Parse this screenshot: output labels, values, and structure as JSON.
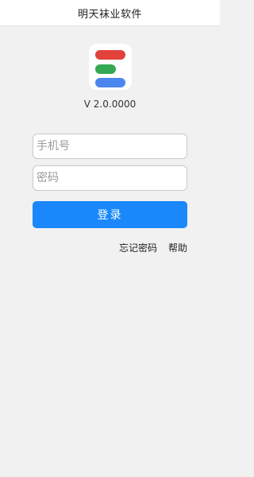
{
  "app": {
    "title": "明天袜业软件",
    "version": "V 2.0.0000"
  },
  "logo": {
    "colors": {
      "top_bar": "#e2423a",
      "middle_bar": "#35a853",
      "bottom_bar": "#4a86ee"
    }
  },
  "form": {
    "phone_placeholder": "手机号",
    "phone_value": "",
    "password_placeholder": "密码",
    "password_value": "",
    "login_label": "登录"
  },
  "links": {
    "forgot_password": "忘记密码",
    "help": "帮助"
  },
  "theme": {
    "accent": "#1a88fb",
    "background": "#f1f1f1"
  }
}
